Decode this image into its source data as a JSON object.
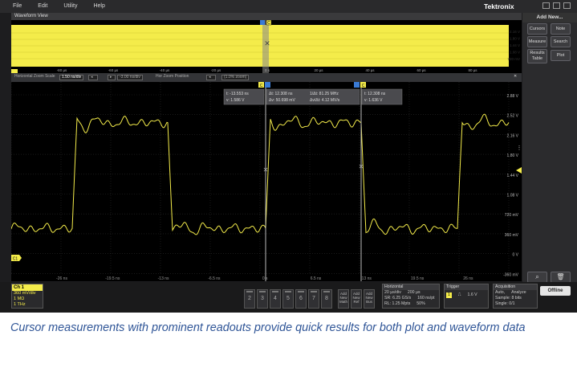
{
  "menu": {
    "items": [
      "File",
      "Edit",
      "Utility",
      "Help"
    ],
    "brand": "Tektronix"
  },
  "waveform_view": {
    "title": "Waveform View"
  },
  "overview": {
    "x_ticks": [
      "-80 µs",
      "-60 µs",
      "-40 µs",
      "-20 µs",
      "0 s",
      "20 µs",
      "40 µs",
      "60 µs",
      "80 µs"
    ],
    "y_ticks": [
      "2.16 V",
      "1.80 V",
      "1.44 V",
      "1.08 V",
      "720 mV"
    ],
    "cursor_label": "C"
  },
  "horizontal_bar": {
    "label": "Horizontal Zoom Scale",
    "zoom_scale": "1.50 ns/div",
    "zoom_position": "-3.00 ns/div",
    "pos_label": "Hor Zoom Position",
    "zoom_pct": "(1.0% zoom)"
  },
  "plot": {
    "y_ticks": [
      "2.88 V",
      "2.52 V",
      "2.16 V",
      "1.80 V",
      "1.44 V",
      "1.08 V",
      "720 mV",
      "360 mV",
      "0 V",
      "-360 mV"
    ],
    "x_ticks": [
      "-26 ns",
      "-19.5 ns",
      "-13 ns",
      "-6.5 ns",
      "0 s",
      "6.5 ns",
      "13 ns",
      "19.5 ns",
      "26 ns"
    ],
    "cursor_a": {
      "label": "C",
      "t": "t: -13.553 ns",
      "v": "v: 1.586 V"
    },
    "cursor_delta": {
      "dt": "Δt: 12.308 ns",
      "inv_dt": "1/Δt: 81.25 MHz",
      "dv": "Δv: 50.698 mV",
      "dv_dt": "Δv/Δt: 4.12 MV/s"
    },
    "cursor_b": {
      "label": "C",
      "t": "t: 12.308 ns",
      "v": "v: 1.636 V"
    },
    "ch_marker": "C1",
    "waveform_color": "#f4ec4a"
  },
  "right_panel": {
    "add_new": "Add New...",
    "buttons": [
      "Cursors",
      "Note",
      "Measure",
      "Search",
      "Results Table",
      "Plot"
    ]
  },
  "channel1": {
    "title": "Ch 1",
    "scale": "360 mV/div",
    "impedance": "1 MΩ",
    "bandwidth": "1 THz"
  },
  "channel_buttons": [
    "2",
    "3",
    "4",
    "5",
    "6",
    "7",
    "8"
  ],
  "add_buttons": [
    {
      "line1": "Add",
      "line2": "New",
      "line3": "Math"
    },
    {
      "line1": "Add",
      "line2": "New",
      "line3": "Ref"
    },
    {
      "line1": "Add",
      "line2": "New",
      "line3": "Bus"
    }
  ],
  "horizontal": {
    "title": "Horizontal",
    "scale": "20 µs/div",
    "duration": "200 µs",
    "sample_rate": "SR: 6.25 GS/s",
    "record": "160 ns/pt",
    "record_length": "RL: 1.25 Mpts",
    "position": "50%"
  },
  "trigger": {
    "title": "Trigger",
    "source": "1",
    "level": "1.6 V"
  },
  "acquisition": {
    "title": "Acquisition",
    "mode": "Auto,",
    "analyze": "Analyze",
    "sample": "Sample: 8 bits",
    "single": "Single: 0/1"
  },
  "offline": "Offline",
  "caption": "Cursor measurements with prominent readouts provide quick results for both plot and waveform data"
}
